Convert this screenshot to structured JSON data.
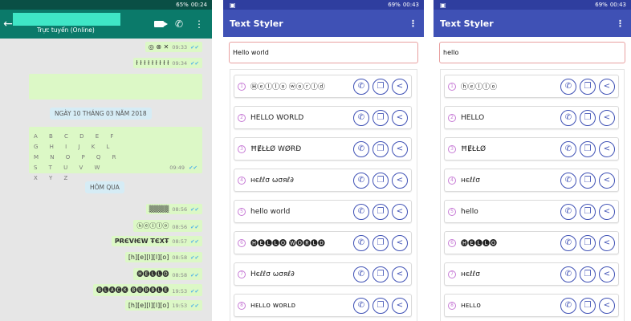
{
  "screen1": {
    "status_time": "00:24",
    "status_battery": "65%",
    "contact_status": "Trực tuyến (Online)",
    "date_pill_1": "NGÀY 10 THÁNG 03 NĂM 2018",
    "date_pill_2": "HÔM QUA",
    "big_grid": "A B C D E F\nG H I J K L\nM N O P Q R\nS T U V W\nX Y Z",
    "messages": [
      {
        "text": "◎ ⊗ ✕",
        "time": "09:33",
        "ticks": "✔✔"
      },
      {
        "text": "ł ł ł ł ł ł ł ł ł",
        "time": "09:34",
        "ticks": "✔✔"
      },
      {
        "text": "",
        "time": "09:49",
        "ticks": "✔✔"
      },
      {
        "text": "▒▒▒▒",
        "time": "08:56",
        "ticks": "✔✔"
      },
      {
        "text": "ⓗⓔⓛⓛⓞ",
        "time": "08:56",
        "ticks": "✔✔"
      },
      {
        "text": "ҎɌЄVłЄW ŦЄXŦ",
        "time": "08:57",
        "ticks": "✔✔"
      },
      {
        "text": "[h][e][l][l][o]",
        "time": "08:58",
        "ticks": "✔✔"
      },
      {
        "text": "🅗🅔🅛🅛🅞",
        "time": "08:58",
        "ticks": "✔✔"
      },
      {
        "text": "🅑🅛🅐🅒🅚 🅑🅤🅑🅑🅛🅔",
        "time": "19:53",
        "ticks": "✔✔"
      },
      {
        "text": "[h][e][l][l][o]",
        "time": "19:53",
        "ticks": "✔✔"
      }
    ]
  },
  "screen2": {
    "status_time": "00:43",
    "status_battery": "69%",
    "app_title": "Text Styler",
    "input_value": "Hello world",
    "rows": [
      {
        "num": "1",
        "text": "Ⓗⓔⓛⓛⓞ ⓦⓞⓡⓛⓓ"
      },
      {
        "num": "2",
        "text": "HELLO WORLD"
      },
      {
        "num": "3",
        "text": "ĦɆŁŁØ WØɌĐ"
      },
      {
        "num": "4",
        "text": "нєℓℓσ ωσяℓ∂"
      },
      {
        "num": "5",
        "text": "hello world"
      },
      {
        "num": "6",
        "text": "🅗🅔🅛🅛🅞 🅦🅞🅡🅛🅓"
      },
      {
        "num": "7",
        "text": "Ηєℓℓσ ωσяℓ∂"
      },
      {
        "num": "8",
        "text": "ʜᴇʟʟᴏ ᴡᴏʀʟᴅ"
      }
    ]
  },
  "screen3": {
    "status_time": "00:43",
    "status_battery": "69%",
    "app_title": "Text Styler",
    "input_value": "hello",
    "rows": [
      {
        "num": "1",
        "text": "ⓗⓔⓛⓛⓞ"
      },
      {
        "num": "2",
        "text": "HELLO"
      },
      {
        "num": "3",
        "text": "ĦɆŁŁØ"
      },
      {
        "num": "4",
        "text": "нєℓℓσ"
      },
      {
        "num": "5",
        "text": "hello"
      },
      {
        "num": "6",
        "text": "🅗🅔🅛🅛🅞"
      },
      {
        "num": "7",
        "text": "нєℓℓσ"
      },
      {
        "num": "8",
        "text": "ʜᴇʟʟᴏ"
      }
    ]
  },
  "icons": {
    "whatsapp": "whatsapp-icon",
    "copy": "copy-icon",
    "share": "share-icon"
  },
  "colors": {
    "whatsapp_header": "#0b7a6a",
    "app_bar": "#3f51b5",
    "bubble": "#dcf8c6"
  }
}
